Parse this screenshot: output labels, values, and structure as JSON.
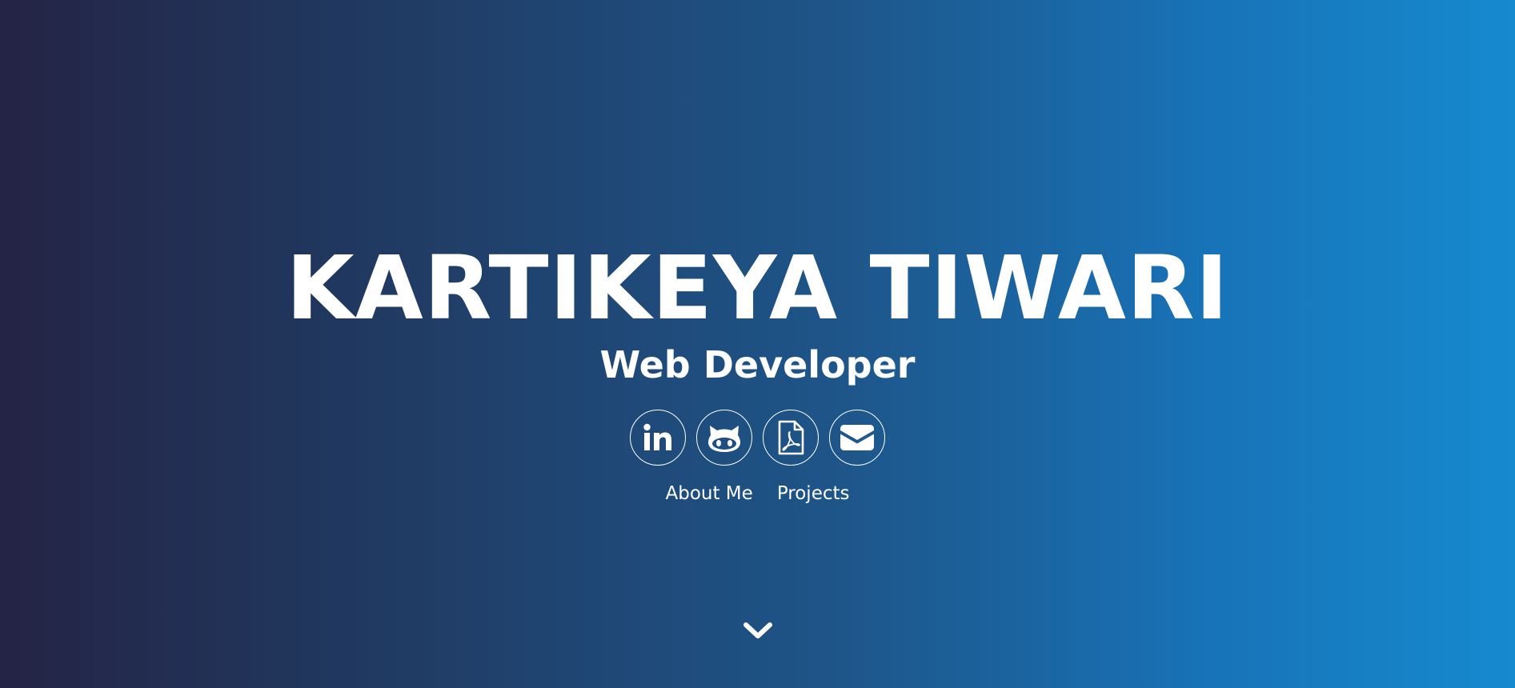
{
  "hero": {
    "name": "KARTIKEYA TIWARI",
    "role": "Web Developer",
    "background_colors": [
      "#242445",
      "#203a62",
      "#1e5589",
      "#1873b8",
      "#168acf"
    ]
  },
  "social": [
    {
      "icon": "linkedin-icon",
      "label": "LinkedIn"
    },
    {
      "icon": "github-icon",
      "label": "GitHub"
    },
    {
      "icon": "pdf-resume-icon",
      "label": "Resume"
    },
    {
      "icon": "email-icon",
      "label": "Email"
    }
  ],
  "nav": {
    "about_label": "About Me",
    "projects_label": "Projects"
  },
  "scroll": {
    "icon": "chevron-down-icon"
  }
}
